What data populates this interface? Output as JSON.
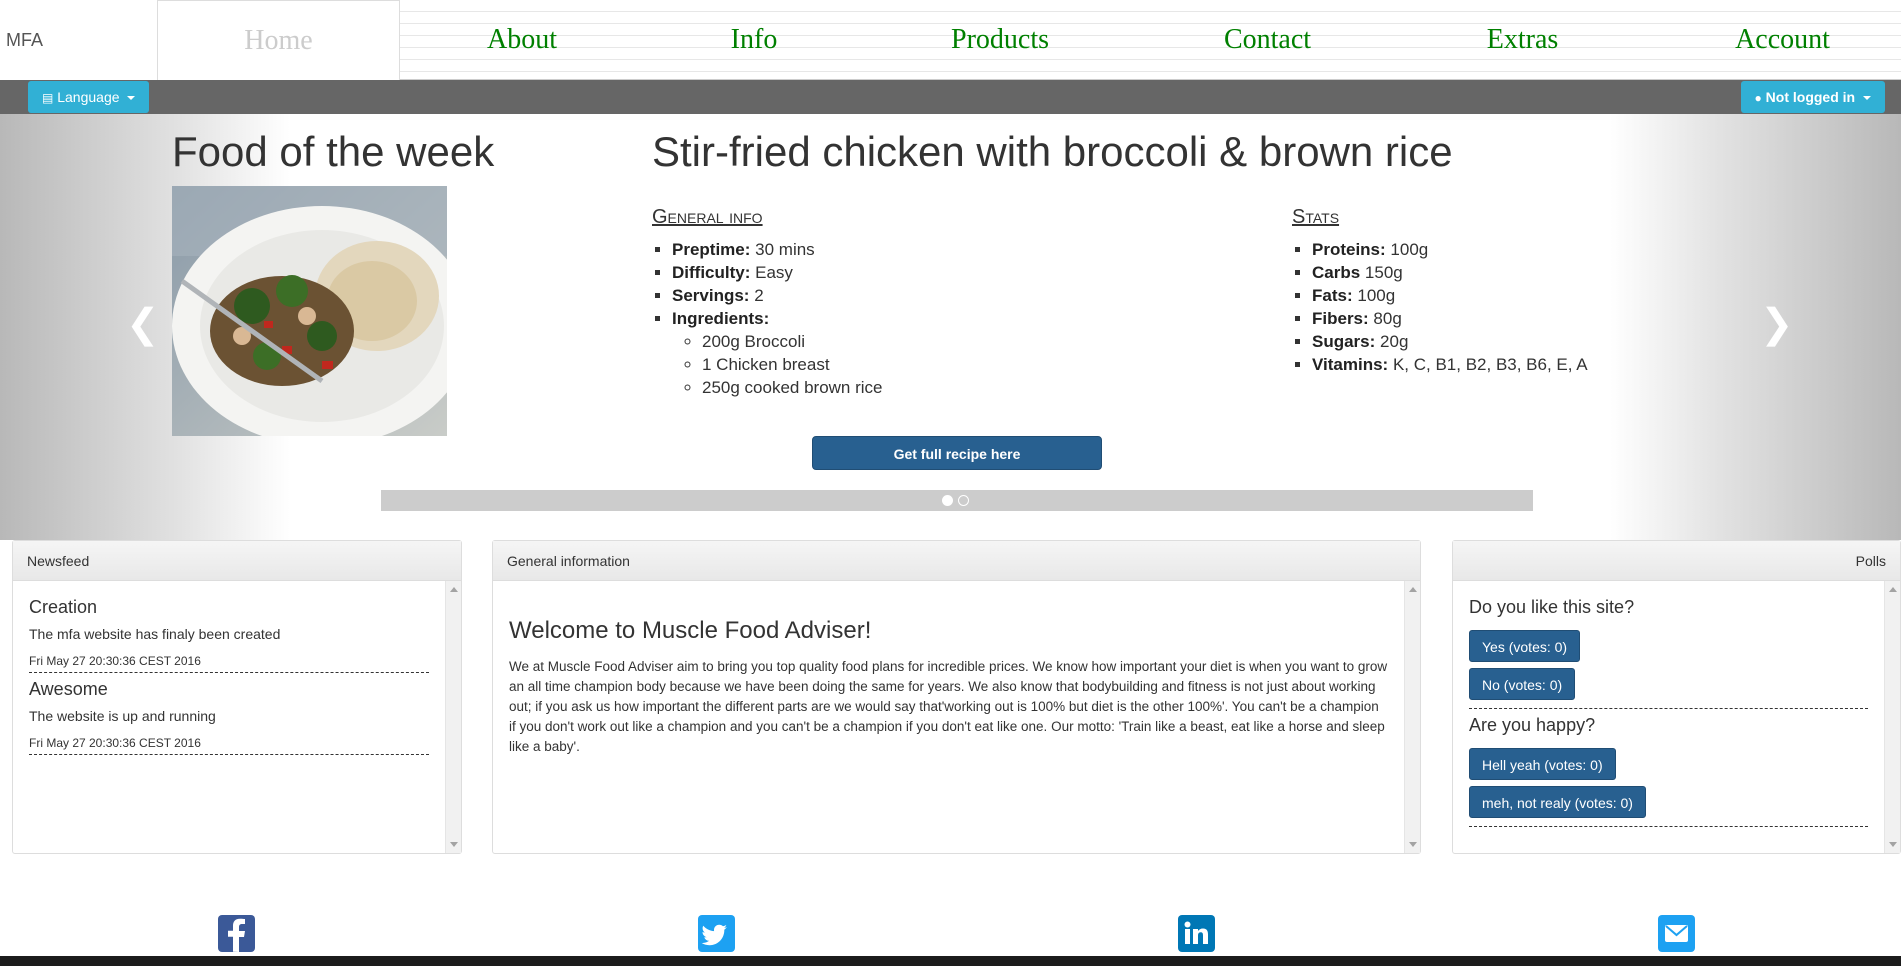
{
  "nav": {
    "brand": "MFA",
    "items": [
      {
        "label": "Home",
        "active": true
      },
      {
        "label": "About"
      },
      {
        "label": "Info"
      },
      {
        "label": "Products"
      },
      {
        "label": "Contact"
      },
      {
        "label": "Extras"
      },
      {
        "label": "Account"
      }
    ],
    "link_color": "#008000"
  },
  "toolbar": {
    "language_label": "Language",
    "account_label": "Not logged in",
    "button_color": "#31b0d5"
  },
  "carousel": {
    "heading": "Food of the week",
    "recipe_title": "Stir-fried chicken with broccoli & brown rice",
    "general_info_heading": "General info",
    "general_info": [
      {
        "key": "Preptime:",
        "value": "30 mins"
      },
      {
        "key": "Difficulty:",
        "value": "Easy"
      },
      {
        "key": "Servings:",
        "value": "2"
      },
      {
        "key": "Ingredients:",
        "value": ""
      }
    ],
    "ingredients": [
      "200g Broccoli",
      "1 Chicken breast",
      "250g cooked brown rice"
    ],
    "stats_heading": "Stats",
    "stats": [
      {
        "key": "Proteins:",
        "value": "100g"
      },
      {
        "key": "Carbs",
        "value": "150g"
      },
      {
        "key": "Fats:",
        "value": "100g"
      },
      {
        "key": "Fibers:",
        "value": "80g"
      },
      {
        "key": "Sugars:",
        "value": "20g"
      },
      {
        "key": "Vitamins:",
        "value": "K, C, B1, B2, B3, B6, E, A"
      }
    ],
    "button_label": "Get full recipe here",
    "active_slide": 1,
    "slide_count": 2
  },
  "newsfeed": {
    "title": "Newsfeed",
    "items": [
      {
        "title": "Creation",
        "text": "The mfa website has finaly been created",
        "date": "Fri May 27 20:30:36 CEST 2016"
      },
      {
        "title": "Awesome",
        "text": "The website is up and running",
        "date": "Fri May 27 20:30:36 CEST 2016"
      }
    ]
  },
  "general": {
    "title": "General information",
    "welcome": "Welcome to Muscle Food Adviser!",
    "text": "We at Muscle Food Adviser aim to bring you top quality food plans for incredible prices. We know how important your diet is when you want to grow an all time champion body because we have been doing the same for years. We also know that bodybuilding and fitness is not just about working out; if you ask us how important the different parts are we would say that'working out is 100% but diet is the other 100%'. You can't be a champion if you don't work out like a champion and you can't be a champion if you don't eat like one. Our motto: 'Train like a beast, eat like a horse and sleep like a baby'."
  },
  "polls": {
    "title": "Polls",
    "items": [
      {
        "question": "Do you like this site?",
        "options": [
          "Yes (votes: 0)",
          "No (votes: 0)"
        ]
      },
      {
        "question": "Are you happy?",
        "options": [
          "Hell yeah (votes: 0)",
          "meh, not realy (votes: 0)"
        ]
      }
    ]
  },
  "footer": {
    "icons": [
      {
        "name": "facebook-icon",
        "color": "#3b5998"
      },
      {
        "name": "twitter-icon",
        "color": "#1da1f2"
      },
      {
        "name": "linkedin-icon",
        "color": "#0077b5"
      },
      {
        "name": "mail-icon",
        "color": "#1da1f2"
      }
    ]
  }
}
